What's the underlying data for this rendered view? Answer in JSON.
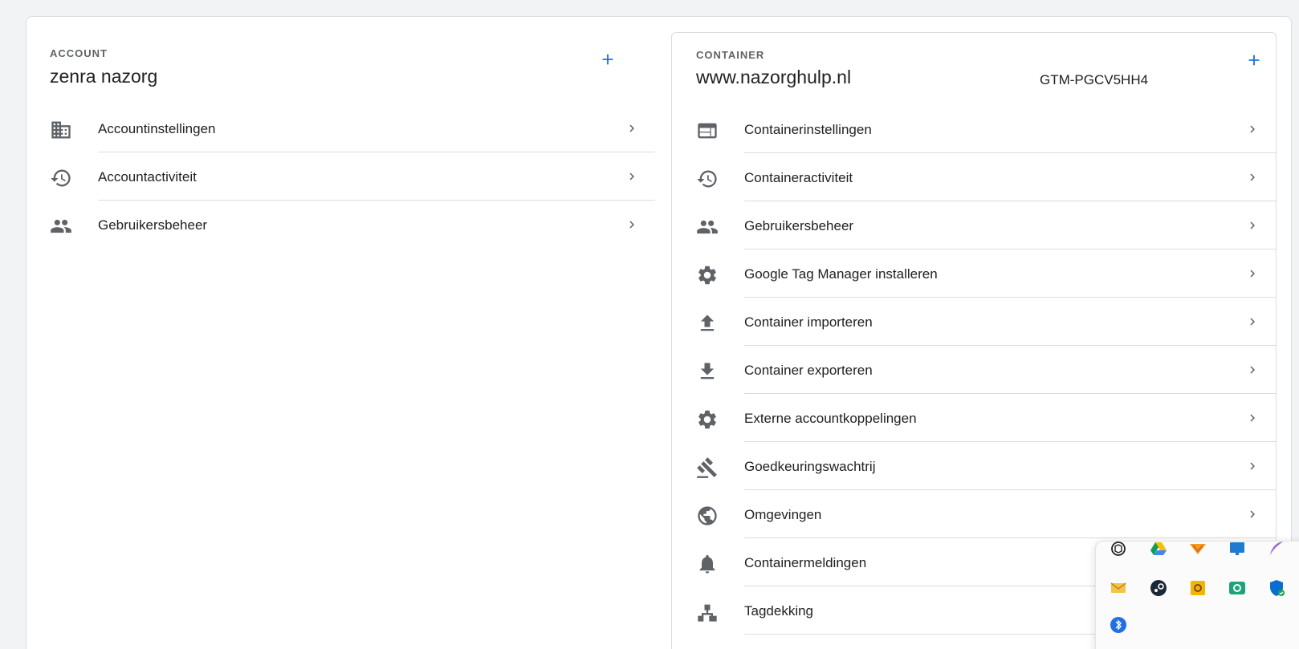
{
  "account": {
    "section_label": "ACCOUNT",
    "name": "zenra nazorg",
    "add_icon": "plus-icon",
    "items": [
      {
        "label": "Accountinstellingen",
        "icon": "building-icon"
      },
      {
        "label": "Accountactiviteit",
        "icon": "history-icon"
      },
      {
        "label": "Gebruikersbeheer",
        "icon": "people-icon"
      }
    ]
  },
  "container": {
    "section_label": "CONTAINER",
    "name": "www.nazorghulp.nl",
    "id": "GTM-PGCV5HH4",
    "add_icon": "plus-icon",
    "items": [
      {
        "label": "Containerinstellingen",
        "icon": "web-window-icon"
      },
      {
        "label": "Containeractiviteit",
        "icon": "history-icon"
      },
      {
        "label": "Gebruikersbeheer",
        "icon": "people-icon"
      },
      {
        "label": "Google Tag Manager installeren",
        "icon": "gear-icon"
      },
      {
        "label": "Container importeren",
        "icon": "upload-icon"
      },
      {
        "label": "Container exporteren",
        "icon": "download-icon"
      },
      {
        "label": "Externe accountkoppelingen",
        "icon": "gear-icon"
      },
      {
        "label": "Goedkeuringswachtrij",
        "icon": "gavel-icon"
      },
      {
        "label": "Omgevingen",
        "icon": "globe-icon"
      },
      {
        "label": "Containermeldingen",
        "icon": "bell-icon"
      },
      {
        "label": "Tagdekking",
        "icon": "sitemap-icon"
      }
    ]
  },
  "tray": {
    "icons": [
      "chatgpt-icon",
      "google-drive-icon",
      "winamp-icon",
      "monitor-icon",
      "feather-icon",
      "mail-icon",
      "steam-icon",
      "outlook-icon",
      "sync-icon",
      "defender-shield-icon",
      "bluetooth-icon"
    ]
  },
  "colors": {
    "accent": "#1a73e8",
    "icon_gray": "#5f6368",
    "divider": "#dadce0",
    "background": "#f1f3f4"
  }
}
